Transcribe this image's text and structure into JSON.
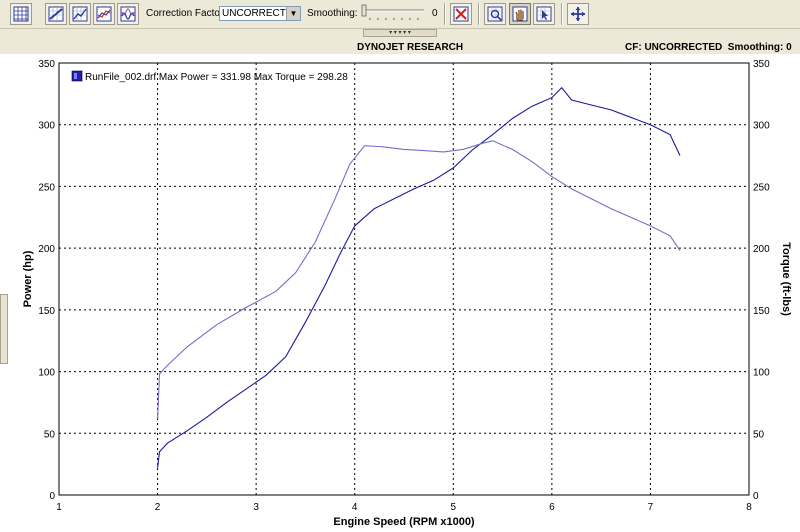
{
  "toolbar": {
    "correction_factor_label": "Correction Factor:",
    "correction_factor_value": "UNCORRECTED",
    "smoothing_label": "Smoothing:",
    "smoothing_value": "0",
    "icons": [
      "grid-icon",
      "chart-edit-icon",
      "chart-line-icon",
      "chart-multi-icon",
      "chart-wave-icon",
      "delete-chart-icon",
      "zoom-grid-icon",
      "hand-pan-icon",
      "cursor-grid-icon",
      "crosshair-move-icon"
    ]
  },
  "header": {
    "title": "DYNOJET RESEARCH",
    "status": "CF: UNCORRECTED  Smoothing: 0"
  },
  "chart_data": {
    "type": "line",
    "legend": "RunFile_002.drf Max Power = 331.98 Max Torque = 298.28",
    "xlabel": "Engine Speed (RPM x1000)",
    "ylabel_left": "Power (hp)",
    "ylabel_right": "Torque (ft-lbs)",
    "xlim": [
      1,
      8
    ],
    "ylim": [
      0,
      350
    ],
    "x_ticks": [
      "1",
      "2",
      "3",
      "4",
      "5",
      "6",
      "7",
      "8"
    ],
    "y_ticks": [
      "0",
      "50",
      "100",
      "150",
      "200",
      "250",
      "300",
      "350"
    ],
    "grid": true,
    "series": [
      {
        "name": "Power",
        "color": "#1a1a9e",
        "points": [
          [
            2.0,
            22
          ],
          [
            2.02,
            35
          ],
          [
            2.1,
            42
          ],
          [
            2.3,
            52
          ],
          [
            2.5,
            63
          ],
          [
            2.7,
            75
          ],
          [
            2.9,
            86
          ],
          [
            3.1,
            97
          ],
          [
            3.3,
            112
          ],
          [
            3.5,
            140
          ],
          [
            3.7,
            170
          ],
          [
            3.85,
            195
          ],
          [
            4.0,
            218
          ],
          [
            4.2,
            232
          ],
          [
            4.4,
            240
          ],
          [
            4.6,
            248
          ],
          [
            4.8,
            255
          ],
          [
            5.0,
            265
          ],
          [
            5.2,
            280
          ],
          [
            5.4,
            292
          ],
          [
            5.6,
            305
          ],
          [
            5.8,
            315
          ],
          [
            6.0,
            322
          ],
          [
            6.1,
            330
          ],
          [
            6.2,
            320
          ],
          [
            6.4,
            316
          ],
          [
            6.6,
            312
          ],
          [
            6.8,
            306
          ],
          [
            7.0,
            300
          ],
          [
            7.2,
            292
          ],
          [
            7.3,
            275
          ]
        ]
      },
      {
        "name": "Torque",
        "color": "#7070c8",
        "points": [
          [
            2.0,
            62
          ],
          [
            2.02,
            98
          ],
          [
            2.1,
            105
          ],
          [
            2.3,
            120
          ],
          [
            2.6,
            138
          ],
          [
            2.9,
            152
          ],
          [
            3.2,
            165
          ],
          [
            3.4,
            180
          ],
          [
            3.6,
            205
          ],
          [
            3.8,
            240
          ],
          [
            3.95,
            268
          ],
          [
            4.1,
            283
          ],
          [
            4.3,
            282
          ],
          [
            4.5,
            280
          ],
          [
            4.7,
            279
          ],
          [
            4.9,
            278
          ],
          [
            5.1,
            280
          ],
          [
            5.3,
            285
          ],
          [
            5.4,
            287
          ],
          [
            5.6,
            280
          ],
          [
            5.8,
            270
          ],
          [
            6.0,
            258
          ],
          [
            6.2,
            248
          ],
          [
            6.4,
            240
          ],
          [
            6.6,
            232
          ],
          [
            6.8,
            225
          ],
          [
            7.0,
            218
          ],
          [
            7.2,
            210
          ],
          [
            7.3,
            198
          ]
        ]
      }
    ]
  }
}
